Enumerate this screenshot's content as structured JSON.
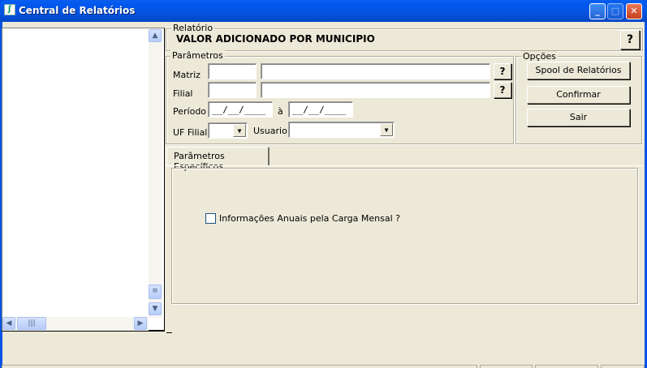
{
  "window": {
    "title": "Central de Relatórios",
    "minimize": "_",
    "maximize": "□",
    "close": "✕"
  },
  "report": {
    "group_label": "Relatório",
    "name": "VALOR ADICIONADO POR MUNICIPIO",
    "help": "?"
  },
  "parameters": {
    "group_label": "Parâmetros",
    "matriz_label": "Matriz",
    "matriz_code": "",
    "matriz_name": "",
    "matriz_help": "?",
    "filial_label": "Filial",
    "filial_code": "",
    "filial_name": "",
    "filial_help": "?",
    "periodo_label": "Período",
    "periodo_from": "__/__/____",
    "periodo_sep": "à",
    "periodo_to": "__/__/____",
    "uf_label": "UF Filial",
    "uf_value": "",
    "usuario_label": "Usuario",
    "usuario_value": ""
  },
  "options": {
    "group_label": "Opções",
    "spool": "Spool de Relatórios",
    "confirm": "Confirmar",
    "exit": "Sair"
  },
  "tabs": [
    {
      "label": "Parâmetros Específicos"
    }
  ],
  "specific": {
    "annual_info_label": "Informações Anuais pela Carga Mensal ?",
    "annual_info_checked": false
  }
}
